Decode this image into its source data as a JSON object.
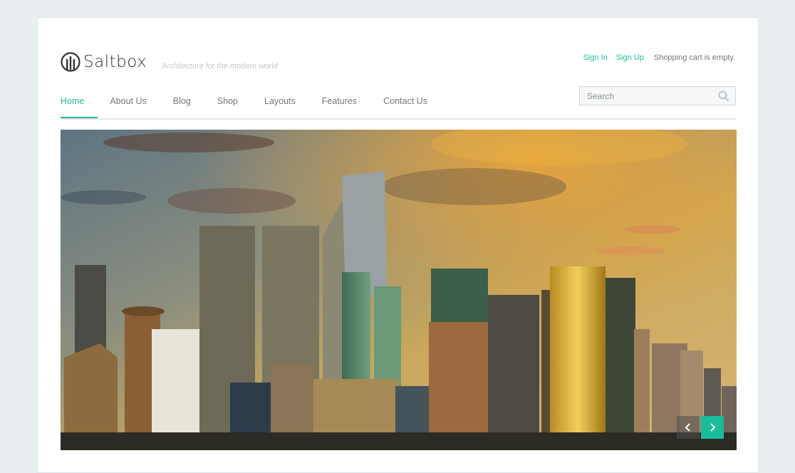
{
  "brand": {
    "name": "Saltbox",
    "tagline": "Architecture for the modern world",
    "accent_color": "#1abc9c"
  },
  "topbar": {
    "sign_in": "Sign In",
    "sign_up": "Sign Up",
    "cart_status": "Shopping cart is empty."
  },
  "nav": {
    "items": [
      {
        "label": "Home",
        "active": true
      },
      {
        "label": "About Us"
      },
      {
        "label": "Blog"
      },
      {
        "label": "Shop"
      },
      {
        "label": "Layouts"
      },
      {
        "label": "Features"
      },
      {
        "label": "Contact Us"
      }
    ]
  },
  "search": {
    "placeholder": "Search",
    "icon": "search-icon"
  },
  "hero": {
    "image_alt": "",
    "prev_icon": "chevron-left-icon",
    "next_icon": "chevron-right-icon"
  }
}
